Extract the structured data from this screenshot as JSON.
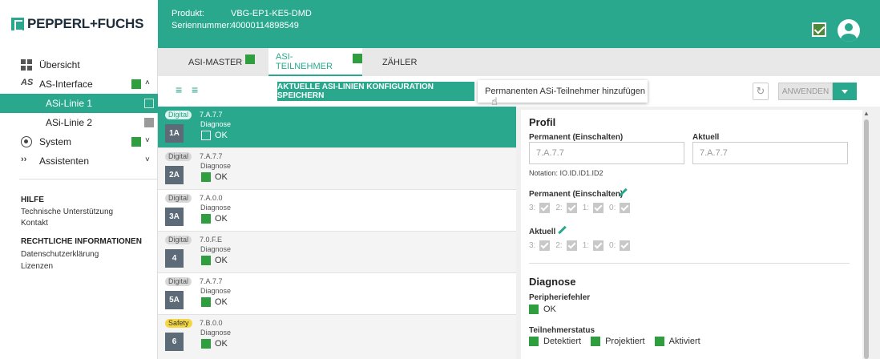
{
  "brand": {
    "name": "PEPPERL+FUCHS"
  },
  "header": {
    "product_label": "Produkt:",
    "product_value": "VBG-EP1-KE5-DMD",
    "serial_label": "Seriennummer:",
    "serial_value": "40000114898549"
  },
  "sidebar": {
    "overview": "Übersicht",
    "as_interface": "AS-Interface",
    "line1": "ASi-Linie 1",
    "line2": "ASi-Linie 2",
    "system": "System",
    "assistants": "Assistenten",
    "help_heading": "HILFE",
    "support": "Technische Unterstützung",
    "contact": "Kontakt",
    "legal_heading": "RECHTLICHE INFORMATIONEN",
    "privacy": "Datenschutzerklärung",
    "licenses": "Lizenzen"
  },
  "tabs": {
    "master": "ASi-MASTER",
    "participant": "ASi-TEILNEHMER",
    "counter": "ZÄHLER"
  },
  "toolbar": {
    "save_label": "AKTUELLE ASI-LINIEN KONFIGURATION SPEICHERN",
    "tooltip": "Permanenten ASi-Teilnehmer hinzufügen",
    "apply_label": "ANWENDEN"
  },
  "participants": [
    {
      "type": "Digital",
      "profile": "7.A.7.7",
      "address": "1A",
      "diag_label": "Diagnose",
      "status": "OK"
    },
    {
      "type": "Digital",
      "profile": "7.A.7.7",
      "address": "2A",
      "diag_label": "Diagnose",
      "status": "OK"
    },
    {
      "type": "Digital",
      "profile": "7.A.0.0",
      "address": "3A",
      "diag_label": "Diagnose",
      "status": "OK"
    },
    {
      "type": "Digital",
      "profile": "7.0.F.E",
      "address": "4",
      "diag_label": "Diagnose",
      "status": "OK"
    },
    {
      "type": "Digital",
      "profile": "7.A.7.7",
      "address": "5A",
      "diag_label": "Diagnose",
      "status": "OK"
    },
    {
      "type": "Safety",
      "profile": "7.B.0.0",
      "address": "6",
      "diag_label": "Diagnose",
      "status": "OK"
    }
  ],
  "detail": {
    "profile_heading": "Profil",
    "permanent_label": "Permanent (Einschalten)",
    "current_label": "Aktuell",
    "permanent_value": "7.A.7.7",
    "current_value": "7.A.7.7",
    "notation": "Notation: IO.ID.ID1.ID2",
    "perm_bits_label": "Permanent (Einschalten)",
    "curr_bits_label": "Aktuell",
    "bits": [
      "3:",
      "2:",
      "1:",
      "0:"
    ],
    "diagnosis_heading": "Diagnose",
    "peripheral_label": "Peripheriefehler",
    "peripheral_status": "OK",
    "participant_status_label": "Teilnehmerstatus",
    "status_detected": "Detektiert",
    "status_projected": "Projektiert",
    "status_activated": "Aktiviert"
  }
}
